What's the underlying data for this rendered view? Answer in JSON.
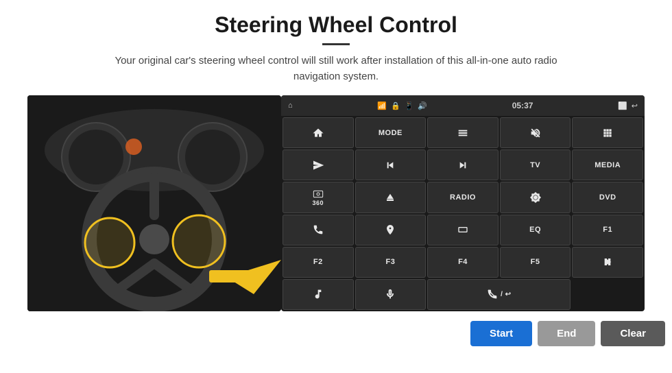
{
  "page": {
    "title": "Steering Wheel Control",
    "subtitle": "Your original car's steering wheel control will still work after installation of this all-in-one auto radio navigation system.",
    "divider": true
  },
  "status_bar": {
    "time": "05:37",
    "icons": [
      "wifi",
      "lock",
      "sim",
      "bluetooth",
      "cast",
      "back"
    ]
  },
  "grid_buttons": [
    {
      "id": "home",
      "type": "icon",
      "icon": "home",
      "label": ""
    },
    {
      "id": "mode",
      "type": "text",
      "label": "MODE"
    },
    {
      "id": "menu",
      "type": "icon",
      "icon": "menu",
      "label": ""
    },
    {
      "id": "mute",
      "type": "icon",
      "icon": "mute",
      "label": ""
    },
    {
      "id": "apps",
      "type": "icon",
      "icon": "apps",
      "label": ""
    },
    {
      "id": "send",
      "type": "icon",
      "icon": "send",
      "label": ""
    },
    {
      "id": "prev",
      "type": "icon",
      "icon": "prev",
      "label": ""
    },
    {
      "id": "next",
      "type": "icon",
      "icon": "next",
      "label": ""
    },
    {
      "id": "tv",
      "type": "text",
      "label": "TV"
    },
    {
      "id": "media",
      "type": "text",
      "label": "MEDIA"
    },
    {
      "id": "360",
      "type": "text",
      "label": "360"
    },
    {
      "id": "eject",
      "type": "icon",
      "icon": "eject",
      "label": ""
    },
    {
      "id": "radio",
      "type": "text",
      "label": "RADIO"
    },
    {
      "id": "brightness",
      "type": "icon",
      "icon": "brightness",
      "label": ""
    },
    {
      "id": "dvd",
      "type": "text",
      "label": "DVD"
    },
    {
      "id": "phone",
      "type": "icon",
      "icon": "phone",
      "label": ""
    },
    {
      "id": "nav",
      "type": "icon",
      "icon": "nav",
      "label": ""
    },
    {
      "id": "rect",
      "type": "icon",
      "icon": "rect",
      "label": ""
    },
    {
      "id": "eq",
      "type": "text",
      "label": "EQ"
    },
    {
      "id": "f1",
      "type": "text",
      "label": "F1"
    },
    {
      "id": "f2",
      "type": "text",
      "label": "F2"
    },
    {
      "id": "f3",
      "type": "text",
      "label": "F3"
    },
    {
      "id": "f4",
      "type": "text",
      "label": "F4"
    },
    {
      "id": "f5",
      "type": "text",
      "label": "F5"
    },
    {
      "id": "playpause",
      "type": "icon",
      "icon": "playpause",
      "label": ""
    },
    {
      "id": "music",
      "type": "icon",
      "icon": "music",
      "label": ""
    },
    {
      "id": "mic",
      "type": "icon",
      "icon": "mic",
      "label": ""
    },
    {
      "id": "call-end",
      "type": "icon",
      "icon": "call-end",
      "label": "",
      "span": 2
    }
  ],
  "bottom_bar": {
    "start_label": "Start",
    "end_label": "End",
    "clear_label": "Clear",
    "start_color": "#1a6fd4",
    "end_color": "#999",
    "clear_color": "#5a5a5a"
  }
}
